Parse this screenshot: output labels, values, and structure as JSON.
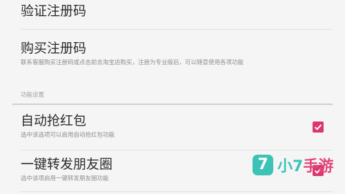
{
  "preferences": {
    "verify": {
      "title": "验证注册码"
    },
    "buy": {
      "title": "购买注册码",
      "summary": "联系客服购买注册码或点击前去淘宝店购买，注册为专业版后，可以随意使用各项功能"
    },
    "category": {
      "label": "功能设置"
    },
    "auto_grab": {
      "title": "自动抢红包",
      "summary": "选中该选项可以启用自动抢红包功能",
      "checked": true
    },
    "moments": {
      "title": "一键转发朋友圈",
      "summary": "选中该项启用一键转发朋友圈功能",
      "checked": true
    }
  },
  "watermark": {
    "logo_char": "7",
    "text_part1": "小7",
    "text_part2": "手游"
  },
  "colors": {
    "checkbox": "#d9376f",
    "watermark_teal": "#3cc3b6",
    "watermark_pink": "#e2477a"
  }
}
